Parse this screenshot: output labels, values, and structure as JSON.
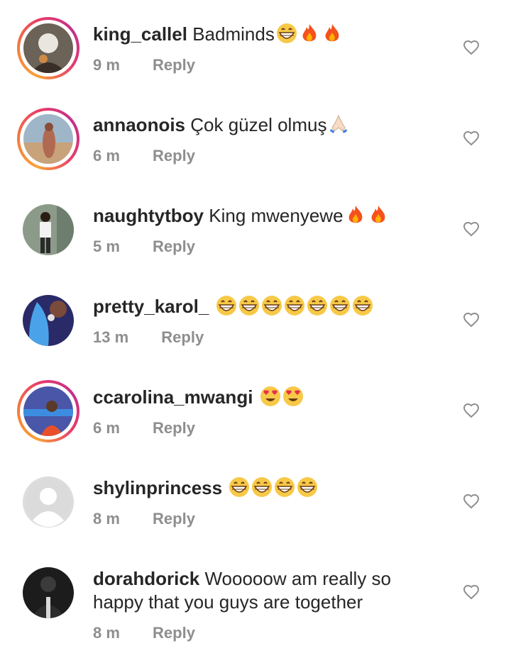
{
  "comments": [
    {
      "username": "king_callel",
      "text": "Badminds",
      "emojis": [
        "grin-icon",
        "fire-icon",
        "fire-icon"
      ],
      "time": "9 m",
      "reply": "Reply",
      "ring": true
    },
    {
      "username": "annaonois",
      "text": "Çok güzel olmuş",
      "emojis": [
        "praying-hands-icon"
      ],
      "time": "6 m",
      "reply": "Reply",
      "ring": true
    },
    {
      "username": "naughtytboy",
      "text": "King mwenyewe",
      "emojis": [
        "fire-icon",
        "fire-icon"
      ],
      "time": "5 m",
      "reply": "Reply",
      "ring": false
    },
    {
      "username": "pretty_karol_",
      "text": "",
      "emojis": [
        "grin-icon",
        "grin-icon",
        "grin-icon",
        "grin-icon",
        "grin-icon",
        "grin-icon",
        "grin-icon"
      ],
      "time": "13 m",
      "reply": "Reply",
      "ring": false
    },
    {
      "username": "ccarolina_mwangi",
      "text": "",
      "emojis": [
        "heart-eyes-icon",
        "heart-eyes-icon"
      ],
      "time": "6 m",
      "reply": "Reply",
      "ring": true
    },
    {
      "username": "shylinprincess",
      "text": "",
      "emojis": [
        "grin-icon",
        "grin-icon",
        "grin-icon",
        "grin-icon"
      ],
      "time": "8 m",
      "reply": "Reply",
      "ring": false
    },
    {
      "username": "dorahdorick",
      "text": "Wooooow am really so happy that you guys are together",
      "emojis": [],
      "time": "8 m",
      "reply": "Reply",
      "ring": false
    }
  ],
  "colors": {
    "username": "#262626",
    "meta": "#8e8e8e",
    "ring_start": "#f9a23a",
    "ring_end": "#c1308c",
    "heart_outline": "#8e8e8e"
  }
}
